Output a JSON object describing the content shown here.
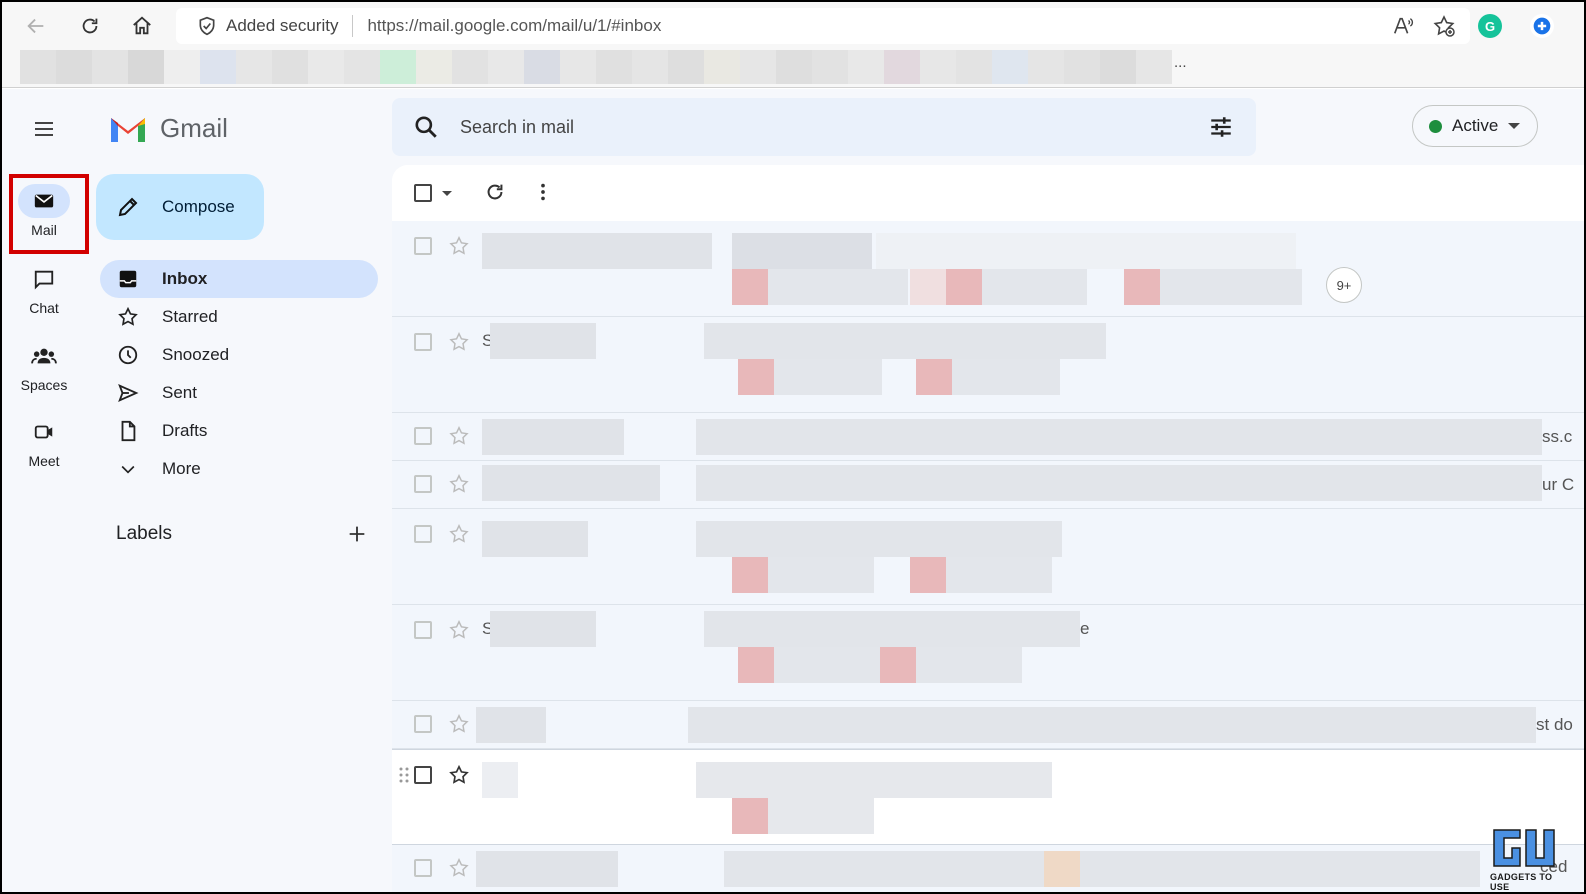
{
  "browser": {
    "security_label": "Added security",
    "url": "https://mail.google.com/mail/u/1/#inbox",
    "bookmarks_overflow": "...",
    "extension_badge": "G"
  },
  "gmail": {
    "logo_text": "Gmail",
    "rail": {
      "items": [
        {
          "label": "Mail",
          "icon": "mail-icon",
          "active": true
        },
        {
          "label": "Chat",
          "icon": "chat-icon",
          "active": false
        },
        {
          "label": "Spaces",
          "icon": "spaces-icon",
          "active": false
        },
        {
          "label": "Meet",
          "icon": "meet-icon",
          "active": false
        }
      ]
    },
    "compose_label": "Compose",
    "folders": [
      {
        "label": "Inbox",
        "icon": "inbox-icon",
        "active": true
      },
      {
        "label": "Starred",
        "icon": "star-icon",
        "active": false
      },
      {
        "label": "Snoozed",
        "icon": "clock-icon",
        "active": false
      },
      {
        "label": "Sent",
        "icon": "send-icon",
        "active": false
      },
      {
        "label": "Drafts",
        "icon": "draft-icon",
        "active": false
      },
      {
        "label": "More",
        "icon": "chevron-down-icon",
        "active": false
      }
    ],
    "labels_title": "Labels",
    "search_placeholder": "Search in mail",
    "status_label": "Active",
    "thread_count_badge": "9+",
    "visible_fragments": {
      "row2_sender": "S",
      "row3_edge": "ss.c",
      "row4_edge": "ur C",
      "row6_sender": "S",
      "row6_snip": "e",
      "row7_edge": "st do",
      "row9_edge": "ced"
    },
    "watermark_text": "GADGETS TO USE",
    "colors": {
      "accent": "#d3e3fd",
      "compose": "#c2e7ff",
      "status_green": "#1e8e3e",
      "highlight_red": "#d20000"
    }
  }
}
